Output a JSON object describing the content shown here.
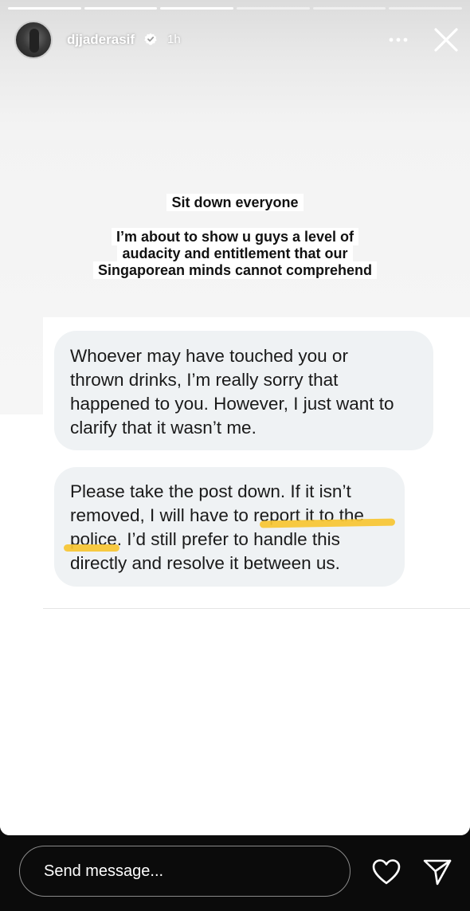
{
  "story": {
    "progress": [
      1,
      1,
      1,
      0,
      0,
      0
    ],
    "username": "djjaderasif",
    "time": "1h"
  },
  "caption": {
    "line1": "Sit down everyone",
    "line2": "I’m about to show u guys a level of",
    "line3": "audacity and entitlement that our",
    "line4": "Singaporean minds cannot comprehend"
  },
  "messages": [
    {
      "text": "Whoever may have touched you or\nthrown drinks, I’m really sorry that\nhappened to you. However, I just want to\nclarify that it wasn’t me."
    },
    {
      "text": "Please take the post down. If it isn’t\nremoved, I will have to report it to the\npolice. I’d still prefer to handle this\ndirectly and resolve it between us."
    }
  ],
  "reply": {
    "placeholder": "Send message..."
  },
  "colors": {
    "highlight": "#f7c631",
    "bubble": "#eff2f4"
  }
}
